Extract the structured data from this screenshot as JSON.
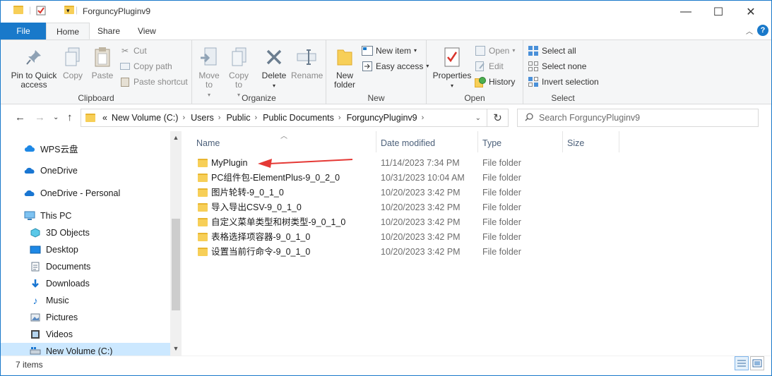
{
  "window": {
    "title": "ForguncyPluginv9",
    "minimize": "—",
    "maximize": "☐",
    "close": "✕"
  },
  "tabs": [
    {
      "label": "File"
    },
    {
      "label": "Home"
    },
    {
      "label": "Share"
    },
    {
      "label": "View"
    }
  ],
  "ribbon": {
    "clipboard": {
      "group_label": "Clipboard",
      "pin_label": "Pin to Quick access",
      "copy_label": "Copy",
      "paste_label": "Paste",
      "cut_label": "Cut",
      "copy_path_label": "Copy path",
      "paste_shortcut_label": "Paste shortcut"
    },
    "organize": {
      "group_label": "Organize",
      "move_to_label": "Move to",
      "copy_to_label": "Copy to",
      "delete_label": "Delete",
      "rename_label": "Rename"
    },
    "new": {
      "group_label": "New",
      "new_folder_label": "New folder",
      "new_item_label": "New item",
      "easy_access_label": "Easy access"
    },
    "open": {
      "group_label": "Open",
      "properties_label": "Properties",
      "open_label": "Open",
      "edit_label": "Edit",
      "history_label": "History"
    },
    "select": {
      "group_label": "Select",
      "select_all_label": "Select all",
      "select_none_label": "Select none",
      "invert_label": "Invert selection"
    }
  },
  "address": {
    "prefix": "«",
    "crumbs": [
      "New Volume (C:)",
      "Users",
      "Public",
      "Public Documents",
      "ForguncyPluginv9"
    ],
    "search_placeholder": "Search ForguncyPluginv9"
  },
  "navpane": {
    "items": [
      {
        "label": "WPS云盘",
        "icon": "cloud-icon"
      },
      {
        "label": "OneDrive",
        "icon": "onedrive-icon"
      },
      {
        "label": "OneDrive - Personal",
        "icon": "onedrive-icon"
      },
      {
        "label": "This PC",
        "icon": "computer-icon"
      },
      {
        "label": "3D Objects",
        "icon": "cube-icon"
      },
      {
        "label": "Desktop",
        "icon": "desktop-icon"
      },
      {
        "label": "Documents",
        "icon": "document-icon"
      },
      {
        "label": "Downloads",
        "icon": "download-icon"
      },
      {
        "label": "Music",
        "icon": "music-icon"
      },
      {
        "label": "Pictures",
        "icon": "picture-icon"
      },
      {
        "label": "Videos",
        "icon": "video-icon"
      },
      {
        "label": "New Volume (C:)",
        "icon": "drive-icon"
      }
    ]
  },
  "filelist": {
    "columns": [
      "Name",
      "Date modified",
      "Type",
      "Size"
    ],
    "rows": [
      {
        "name": "MyPlugin",
        "date": "11/14/2023 7:34 PM",
        "type": "File folder"
      },
      {
        "name": "PC组件包-ElementPlus-9_0_2_0",
        "date": "10/31/2023 10:04 AM",
        "type": "File folder"
      },
      {
        "name": "图片轮转-9_0_1_0",
        "date": "10/20/2023 3:42 PM",
        "type": "File folder"
      },
      {
        "name": "导入导出CSV-9_0_1_0",
        "date": "10/20/2023 3:42 PM",
        "type": "File folder"
      },
      {
        "name": "自定义菜单类型和树类型-9_0_1_0",
        "date": "10/20/2023 3:42 PM",
        "type": "File folder"
      },
      {
        "name": "表格选择项容器-9_0_1_0",
        "date": "10/20/2023 3:42 PM",
        "type": "File folder"
      },
      {
        "name": "设置当前行命令-9_0_1_0",
        "date": "10/20/2023 3:42 PM",
        "type": "File folder"
      }
    ]
  },
  "status": {
    "item_count": "7 items"
  },
  "colors": {
    "accent": "#1979ca",
    "selection": "#cce8ff",
    "arrow": "#e53935"
  }
}
